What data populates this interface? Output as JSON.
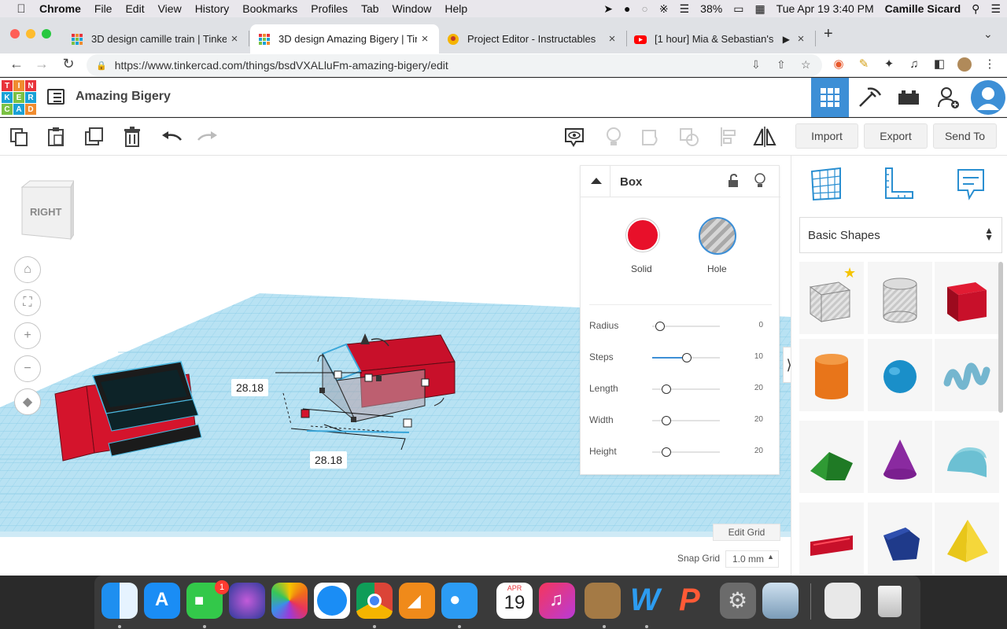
{
  "menubar": {
    "app_name": "Chrome",
    "items": [
      "File",
      "Edit",
      "View",
      "History",
      "Bookmarks",
      "Profiles",
      "Tab",
      "Window",
      "Help"
    ],
    "battery": "38%",
    "datetime": "Tue Apr 19  3:40 PM",
    "user": "Camille Sicard"
  },
  "tabs": [
    {
      "title": "3D design camille train | Tinker",
      "active": false
    },
    {
      "title": "3D design Amazing Bigery | Tin",
      "active": true
    },
    {
      "title": "Project Editor - Instructables",
      "active": false
    },
    {
      "title": "[1 hour] Mia & Sebastian's",
      "active": false
    }
  ],
  "address_bar": {
    "url": "https://www.tinkercad.com/things/bsdVXALluFm-amazing-bigery/edit"
  },
  "tinkercad": {
    "logo_letters": [
      "T",
      "I",
      "N",
      "K",
      "E",
      "R",
      "C",
      "A",
      "D"
    ],
    "design_name": "Amazing Bigery",
    "actions": {
      "import": "Import",
      "export": "Export",
      "send_to": "Send To"
    }
  },
  "workplane": {
    "viewcube_label": "RIGHT",
    "dimension_width": "28.18",
    "dimension_length": "28.18",
    "edit_grid": "Edit Grid",
    "snap_grid_label": "Snap Grid",
    "snap_grid_value": "1.0 mm"
  },
  "inspector": {
    "shape_name": "Box",
    "solid_label": "Solid",
    "hole_label": "Hole",
    "solid_color": "#e8102a",
    "params": [
      {
        "label": "Radius",
        "value": "0",
        "level": 0
      },
      {
        "label": "Steps",
        "value": "10",
        "level": 0.44
      },
      {
        "label": "Length",
        "value": "20",
        "level": 0
      },
      {
        "label": "Width",
        "value": "20",
        "level": 0
      },
      {
        "label": "Height",
        "value": "20",
        "level": 0
      }
    ]
  },
  "shapes_panel": {
    "category": "Basic Shapes",
    "shapes": [
      "box-hole",
      "cylinder-hole",
      "box",
      "cylinder",
      "sphere",
      "scribble",
      "roof",
      "cone",
      "round-roof",
      "text",
      "polygon",
      "pyramid"
    ]
  },
  "dock": {
    "facetime_badge": "1",
    "calendar_month": "APR",
    "calendar_day": "19"
  },
  "colors": {
    "accent_blue": "#3d8fd6",
    "grid_blue": "#7dc7e4",
    "shape_red": "#d4142c"
  }
}
